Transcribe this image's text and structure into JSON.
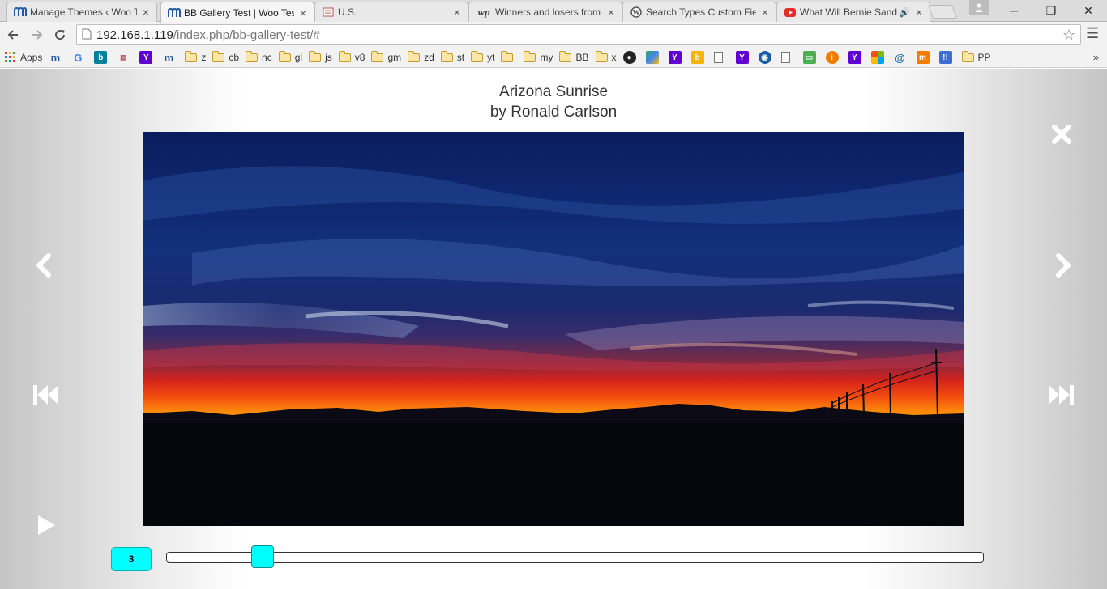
{
  "tabs": [
    {
      "title": "Manage Themes ‹ Woo Test",
      "favicon": "woo-m-icon",
      "active": false
    },
    {
      "title": "BB Gallery Test | Woo Test",
      "favicon": "woo-m-icon",
      "active": true
    },
    {
      "title": "U.S.",
      "favicon": "news-icon",
      "active": false
    },
    {
      "title": "Winners and losers from",
      "favicon": "wp-washington-post-icon",
      "active": false
    },
    {
      "title": "Search Types Custom Field",
      "favicon": "wordpress-icon",
      "active": false
    },
    {
      "title": "What Will Bernie Sand",
      "favicon": "youtube-icon",
      "active": false,
      "audio": true
    }
  ],
  "toolbar": {
    "url_host": "192.168.1.119",
    "url_path": "/index.php/bb-gallery-test/#"
  },
  "bookmarks": {
    "apps_label": "Apps",
    "folders": [
      "z",
      "cb",
      "nc",
      "gl",
      "js",
      "v8",
      "gm",
      "zd",
      "st",
      "yt",
      "",
      "my",
      "BB",
      "x"
    ],
    "last_folder": "PP"
  },
  "gallery": {
    "caption_title": "Arizona Sunrise",
    "caption_author": "by Ronald Carlson",
    "current_index": "3",
    "slider_position": 0.065,
    "accent_color": "#00ffff"
  }
}
